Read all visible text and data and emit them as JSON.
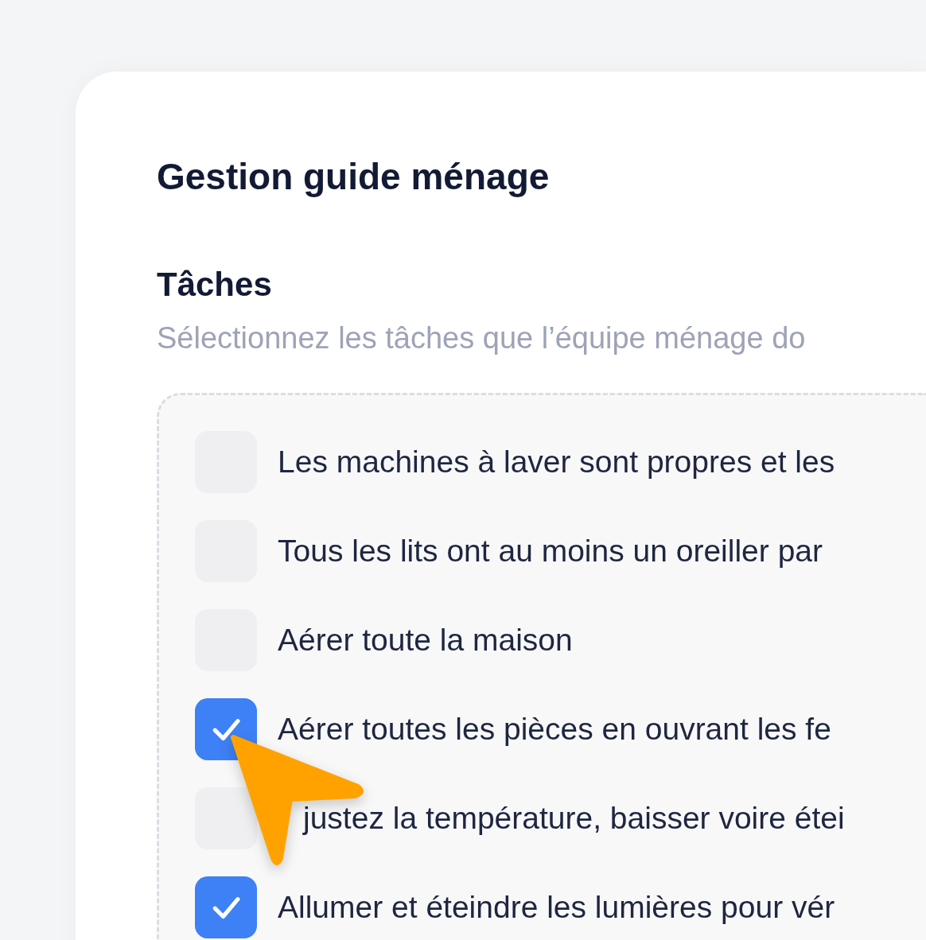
{
  "title": "Gestion guide ménage",
  "section": {
    "heading": "Tâches",
    "description": "Sélectionnez les tâches que l’équipe ménage do"
  },
  "tasks": [
    {
      "label": "Les machines à laver sont propres et les",
      "checked": false,
      "under_cursor": false
    },
    {
      "label": "Tous les lits ont au moins un oreiller par",
      "checked": false,
      "under_cursor": false
    },
    {
      "label": "Aérer toute la maison",
      "checked": false,
      "under_cursor": false
    },
    {
      "label": "Aérer toutes les pièces en ouvrant les fe",
      "checked": true,
      "under_cursor": false
    },
    {
      "label": "justez la température, baisser voire étei",
      "checked": false,
      "under_cursor": true
    },
    {
      "label": "Allumer et éteindre les lumières pour vér",
      "checked": true,
      "under_cursor": false
    }
  ]
}
